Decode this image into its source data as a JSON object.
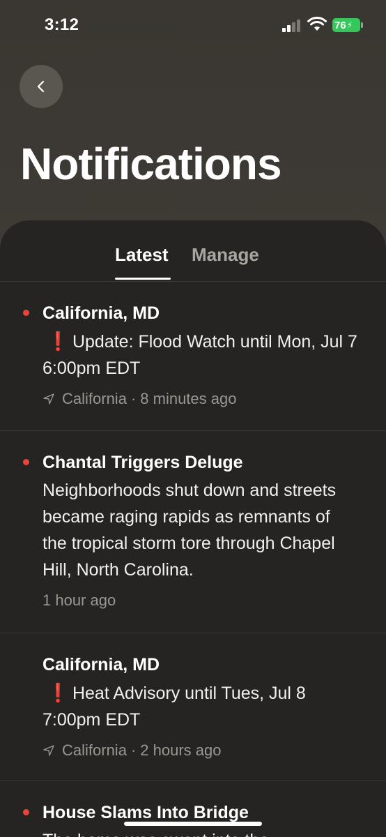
{
  "status_bar": {
    "time": "3:12",
    "battery": "76",
    "battery_color": "#34c759"
  },
  "header": {
    "title": "Notifications",
    "back_icon": "chevron-left-icon"
  },
  "tabs": [
    {
      "label": "Latest",
      "active": true
    },
    {
      "label": "Manage",
      "active": false
    }
  ],
  "notifications": [
    {
      "title": "California, MD",
      "body": "Update: Flood Watch until Mon, Jul 7 6:00pm EDT",
      "alert_symbol": "❗",
      "location": "California",
      "separator": "·",
      "time": "8 minutes ago",
      "unread": true
    },
    {
      "title": "Chantal Triggers Deluge",
      "body": "Neighborhoods shut down and streets became raging rapids as remnants of the tropical storm tore through Chapel Hill, North Carolina.",
      "time": "1 hour ago",
      "unread": true
    },
    {
      "title": "California, MD",
      "body": "Heat Advisory until Tues, Jul 8 7:00pm EDT",
      "alert_symbol": "❗",
      "location": "California",
      "separator": "·",
      "time": "2 hours ago",
      "unread": false
    },
    {
      "title": "House Slams Into Bridge",
      "body": "The home was swept into the",
      "unread": true
    }
  ],
  "colors": {
    "unread_dot": "#e8453c",
    "sheet_bg": "#262422",
    "header_bg": "#3b3833"
  }
}
